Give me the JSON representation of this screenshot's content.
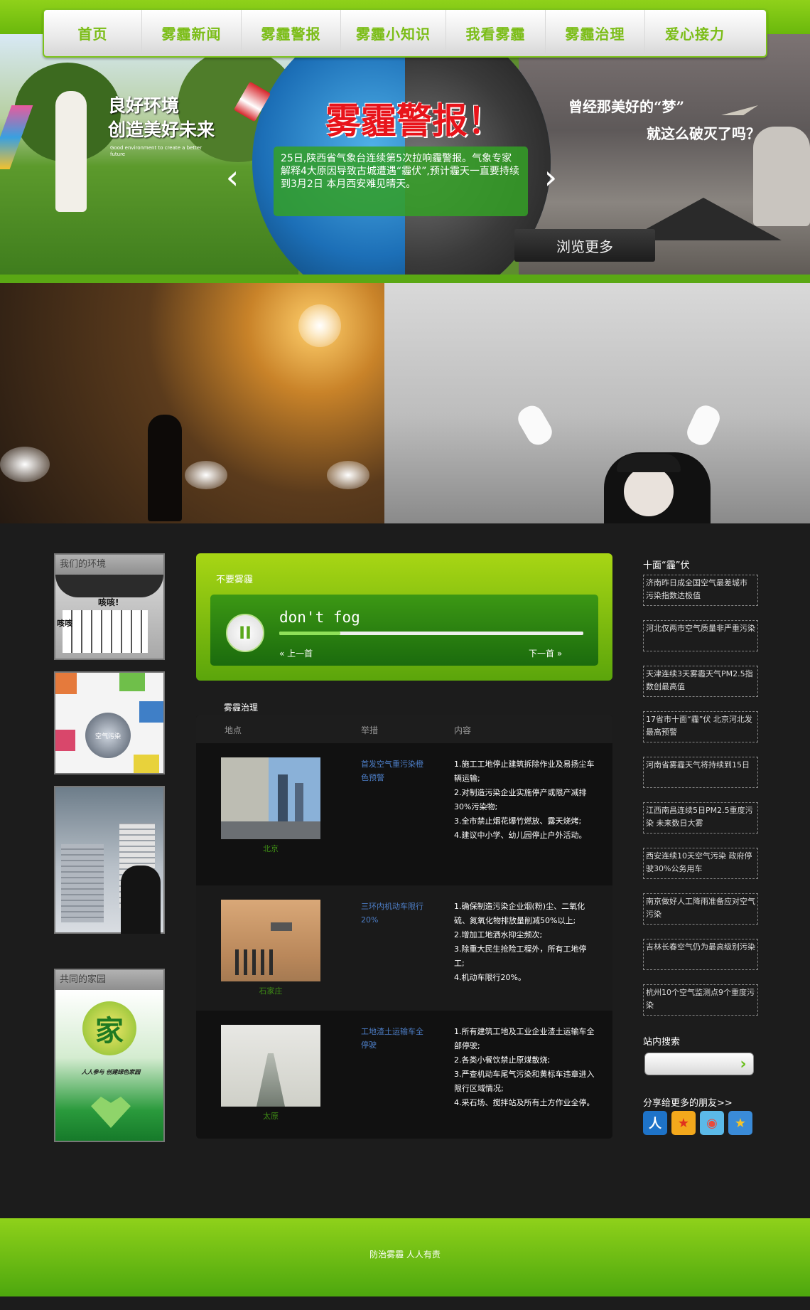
{
  "nav": {
    "items": [
      "首页",
      "雾霾新闻",
      "雾霾警报",
      "雾霾小知识",
      "我看雾霾",
      "雾霾治理",
      "爱心接力"
    ]
  },
  "hero": {
    "slogan_left_line1": "良好环境",
    "slogan_left_line2": "创造美好未来",
    "slogan_left_sub": "Good environment to create a better future",
    "title": "雾霾警报！",
    "dream_line1": "曾经那美好的“梦”",
    "dream_line2": "就这么破灭了吗？",
    "news": "25日,陕西省气象台连续第5次拉响霾警报。气象专家解释4大原因导致古城遭遇“霾伏”,预计霾天一直要持续到3月2日 本月西安难见晴天。",
    "prev_arrow": "‹",
    "next_arrow": "›",
    "more_button": "浏览更多"
  },
  "left_sidebar": {
    "card1_title": "我们的环境",
    "card1_bubble1": "咳咳!",
    "card1_bubble2": "咳咳",
    "card2_text": "空气污染",
    "card4_title": "共同的家园",
    "card4_main": "家",
    "card4_sub": "人人参与 创建绿色家园"
  },
  "player": {
    "title": "不要雾霾",
    "song": "don't fog",
    "progress": 0.2,
    "pause_icon": "II",
    "prev_label": "上一首",
    "next_label": "下一首"
  },
  "table": {
    "title": "雾霾治理",
    "headers": [
      "地点",
      "举措",
      "内容"
    ],
    "rows": [
      {
        "city": "北京",
        "measure": "首发空气重污染橙色预警",
        "content": "1.施工工地停止建筑拆除作业及易扬尘车辆运输;\n2.对制造污染企业实施停产或限产减排30%污染物;\n3.全市禁止烟花爆竹燃放、露天烧烤;\n4.建议中小学、幼儿园停止户外活动。"
      },
      {
        "city": "石家庄",
        "measure": "三环内机动车限行20%",
        "content": "1.确保制造污染企业烟(粉)尘、二氧化硫、氮氧化物排放量削减50%以上;\n2.增加工地洒水抑尘频次;\n3.除重大民生抢险工程外，所有工地停工;\n4.机动车限行20%。"
      },
      {
        "city": "太原",
        "measure": "工地渣土运输车全停驶",
        "content": "1.所有建筑工地及工业企业渣土运输车全部停驶;\n2.各类小餐饮禁止原煤散烧;\n3.严查机动车尾气污染和黄标车违章进入限行区域情况;\n4.采石场、搅拌站及所有土方作业全停。"
      }
    ]
  },
  "right_sidebar": {
    "news_title": "十面“霾”伏",
    "news": [
      "济南昨日成全国空气最差城市 污染指数达极值",
      "河北仅两市空气质量非严重污染",
      "天津连续3天雾霾天气PM2.5指数创最高值",
      "17省市十面“霾”伏 北京河北发最高预警",
      "河南省雾霾天气将持续到15日",
      "江西南昌连续5日PM2.5重度污染 未来数日大雾",
      "西安连续10天空气污染 政府停驶30%公务用车",
      "南京做好人工降雨准备应对空气污染",
      "吉林长春空气仍为最高级别污染",
      "杭州10个空气监测点9个重度污染"
    ],
    "search_title": "站内搜索",
    "search_value": "",
    "search_go": "›",
    "share_title": "分享给更多的朋友>>",
    "share_icons": [
      {
        "name": "renren-icon",
        "glyph": "人",
        "color": "#1e73c8"
      },
      {
        "name": "kaixin-icon",
        "glyph": "★",
        "color": "#e0321e"
      },
      {
        "name": "weibo-icon",
        "glyph": "◉",
        "color": "#e94a3a"
      },
      {
        "name": "qzone-icon",
        "glyph": "★",
        "color": "#3a8bd8"
      }
    ]
  },
  "footer": {
    "text": "防治雾霾 人人有责"
  },
  "colors": {
    "accent_green": "#7bbd17",
    "dark_bg": "#1c1c1c",
    "link_blue": "#4d7ec7",
    "alert_red": "#e8141b"
  }
}
